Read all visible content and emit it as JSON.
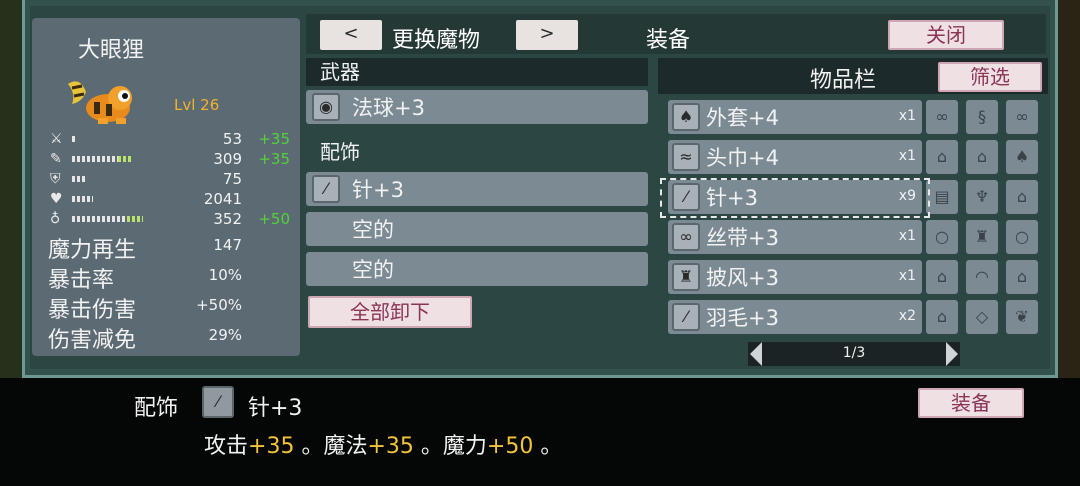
{
  "character": {
    "name": "大眼狸",
    "level": "Lvl 26",
    "stats": [
      {
        "icon": "sword-icon",
        "glyph": "⚔",
        "value": "53",
        "bonus": "+35",
        "bar_fraction": 0.02,
        "bonus_fraction": 0
      },
      {
        "icon": "wand-icon",
        "glyph": "✎",
        "value": "309",
        "bonus": "+35",
        "bar_fraction": 0.35,
        "bonus_fraction": 0.1
      },
      {
        "icon": "shield-icon",
        "glyph": "⛨",
        "value": "75",
        "bonus": "",
        "bar_fraction": 0.1,
        "bonus_fraction": 0
      },
      {
        "icon": "heart-icon",
        "glyph": "♥",
        "value": "2041",
        "bonus": "",
        "bar_fraction": 0.16,
        "bonus_fraction": 0
      },
      {
        "icon": "potion-icon",
        "glyph": "♁",
        "value": "352",
        "bonus": "+50",
        "bar_fraction": 0.42,
        "bonus_fraction": 0.12
      }
    ],
    "attributes": [
      {
        "label": "魔力再生",
        "value": "147"
      },
      {
        "label": "暴击率",
        "value": "10%"
      },
      {
        "label": "暴击伤害",
        "value": "+50%"
      },
      {
        "label": "伤害减免",
        "value": "29%"
      }
    ]
  },
  "header": {
    "prev_label": "<",
    "next_label": ">",
    "switch_label": "更换魔物",
    "tab_title": "装备",
    "close_label": "关闭"
  },
  "equipment": {
    "weapon_header": "武器",
    "weapon": {
      "icon": "orb-icon",
      "glyph": "◉",
      "name": "法球+3"
    },
    "accessory_header": "配饰",
    "accessories": [
      {
        "icon": "needle-icon",
        "glyph": "⁄",
        "name": "针+3"
      },
      {
        "icon": "",
        "glyph": "",
        "name": "空的"
      },
      {
        "icon": "",
        "glyph": "",
        "name": "空的"
      }
    ],
    "unequip_all_label": "全部卸下"
  },
  "inventory": {
    "title": "物品栏",
    "filter_label": "筛选",
    "items": [
      {
        "icon": "coat-icon",
        "glyph": "♠",
        "name": "外套+4",
        "qty": "x1",
        "minis": [
          "goggles-icon",
          "figure-icon",
          "goggles-icon"
        ],
        "mini_glyphs": [
          "∞",
          "§",
          "∞"
        ]
      },
      {
        "icon": "scarf-icon",
        "glyph": "≈",
        "name": "头巾+4",
        "qty": "x1",
        "minis": [
          "lock-icon",
          "lock-icon",
          "coat-icon"
        ],
        "mini_glyphs": [
          "⌂",
          "⌂",
          "♠"
        ]
      },
      {
        "icon": "needle-icon",
        "glyph": "⁄",
        "name": "针+3",
        "qty": "x9",
        "minis": [
          "book-icon",
          "feather-icon",
          "lock-icon"
        ],
        "mini_glyphs": [
          "▤",
          "♆",
          "⌂"
        ]
      },
      {
        "icon": "ribbon-icon",
        "glyph": "∞",
        "name": "丝带+3",
        "qty": "x1",
        "minis": [
          "ring-icon",
          "cape-icon",
          "ring-icon"
        ],
        "mini_glyphs": [
          "○",
          "♜",
          "○"
        ]
      },
      {
        "icon": "cape-icon",
        "glyph": "♜",
        "name": "披风+3",
        "qty": "x1",
        "minis": [
          "lock-icon",
          "hat-icon",
          "lock-icon"
        ],
        "mini_glyphs": [
          "⌂",
          "◠",
          "⌂"
        ]
      },
      {
        "icon": "feather-icon",
        "glyph": "⁄",
        "name": "羽毛+3",
        "qty": "x2",
        "minis": [
          "lock-icon",
          "shell-icon",
          "claw-icon"
        ],
        "mini_glyphs": [
          "⌂",
          "◇",
          "❦"
        ]
      }
    ],
    "page_text": "1/3"
  },
  "detail": {
    "category": "配饰",
    "icon": "needle-icon",
    "glyph": "⁄",
    "name": "针+3",
    "effects": [
      {
        "label": "攻击",
        "value": "+35"
      },
      {
        "label": "魔法",
        "value": "+35"
      },
      {
        "label": "魔力",
        "value": "+50"
      }
    ],
    "equip_label": "装备"
  },
  "colors": {
    "accent_green": "#53d13c",
    "level_gold": "#f0b429",
    "effect_gold": "#f3c43a",
    "button_pink_text": "#8a3456"
  }
}
